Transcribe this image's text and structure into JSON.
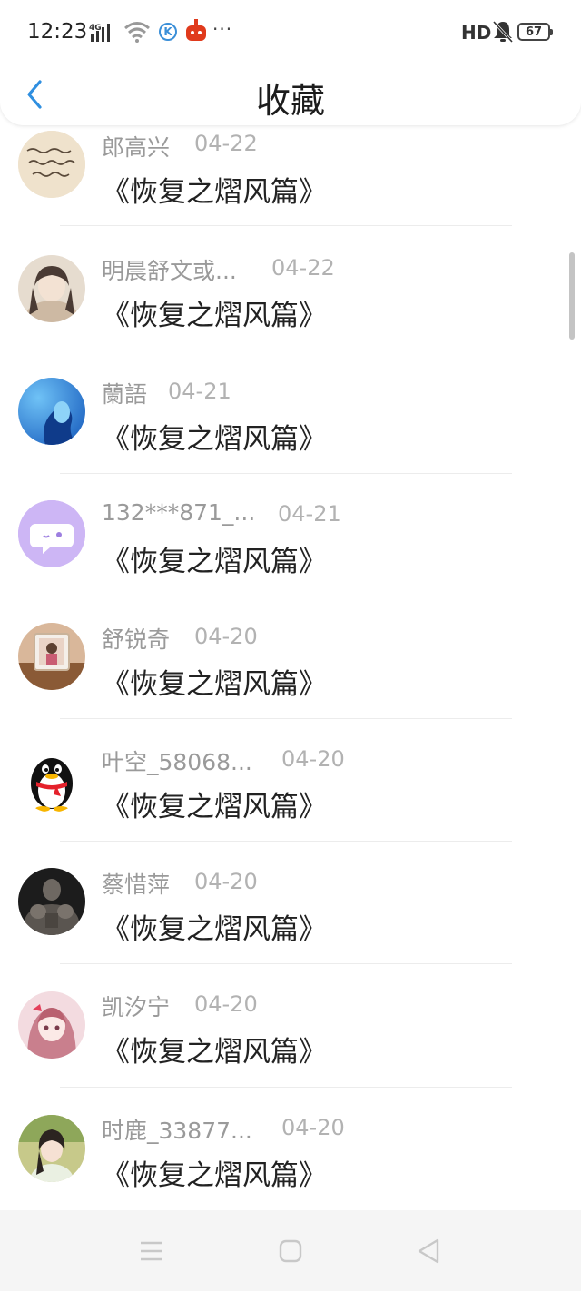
{
  "status_bar": {
    "time": "12:23",
    "network": "4G",
    "hd": "HD",
    "battery": "67",
    "more": "···",
    "app_k_label": "K"
  },
  "header": {
    "title": "收藏",
    "back_icon": "chevron-left-icon",
    "accent_color": "#2f8fe0"
  },
  "favorites": [
    {
      "name": "郎高兴",
      "date": "04-22",
      "title": "《恢复之熠风篇》",
      "avatar": "handwriting"
    },
    {
      "name": "明晨舒文或...",
      "date": "04-22",
      "title": "《恢复之熠风篇》",
      "avatar": "illustration-girl"
    },
    {
      "name": "蘭語",
      "date": "04-21",
      "title": "《恢复之熠风篇》",
      "avatar": "blue-portrait"
    },
    {
      "name": "132***871_...",
      "date": "04-21",
      "title": "《恢复之熠风篇》",
      "avatar": "purple-chat"
    },
    {
      "name": "舒锐奇",
      "date": "04-20",
      "title": "《恢复之熠风篇》",
      "avatar": "photo-frame"
    },
    {
      "name": "叶空_58068...",
      "date": "04-20",
      "title": "《恢复之熠风篇》",
      "avatar": "qq-penguin"
    },
    {
      "name": "蔡惜萍",
      "date": "04-20",
      "title": "《恢复之熠风篇》",
      "avatar": "muscle-man"
    },
    {
      "name": "凯汐宁",
      "date": "04-20",
      "title": "《恢复之熠风篇》",
      "avatar": "anime-girl"
    },
    {
      "name": "时鹿_33877...",
      "date": "04-20",
      "title": "《恢复之熠风篇》",
      "avatar": "woman-portrait"
    }
  ],
  "nav_bar": {
    "menu_icon": "menu-icon",
    "home_icon": "home-square-icon",
    "back_icon": "back-triangle-icon"
  }
}
